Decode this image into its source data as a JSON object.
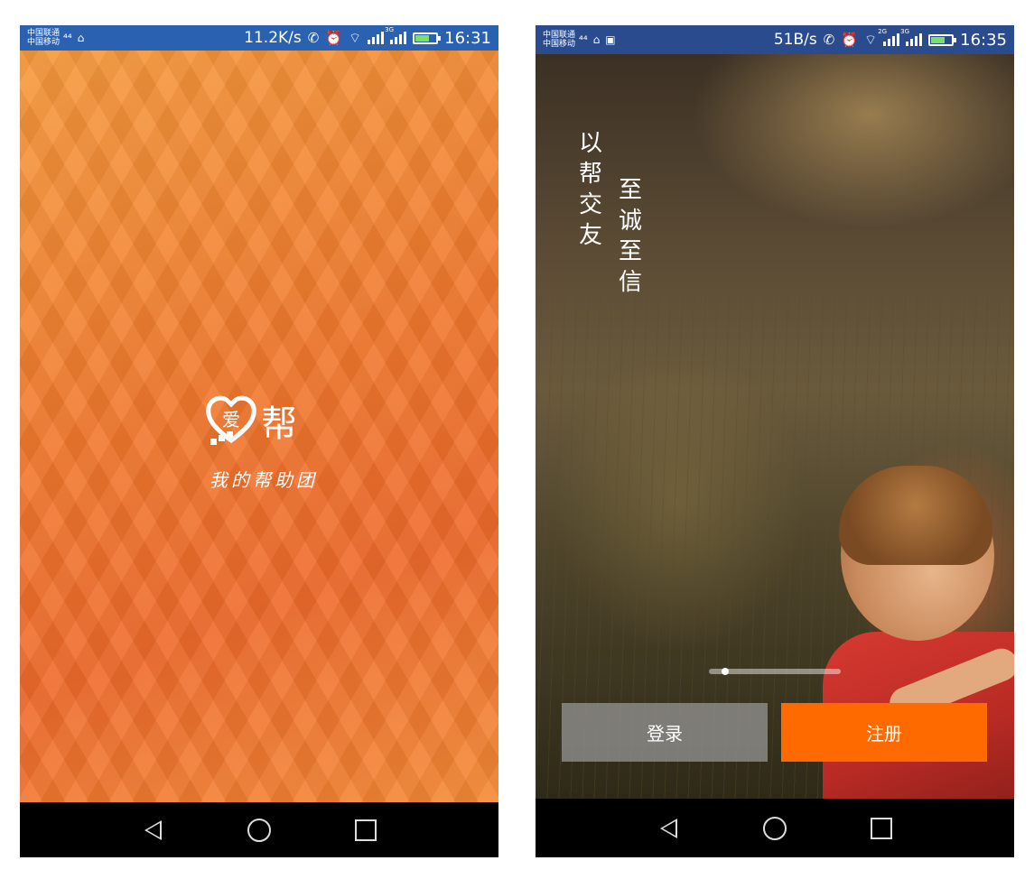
{
  "splash_screen": {
    "status_bar": {
      "carrier_top": "中国联通",
      "carrier_bottom": "中国移动",
      "network_speed": "11.2K/s",
      "signal_1_tag": "",
      "signal_2_tag": "3G",
      "time": "16:31"
    },
    "logo_text": "帮",
    "logo_icon": "heart-ai-icon",
    "slogan": "我的帮助团",
    "background_color": "#f07a2e"
  },
  "login_screen": {
    "status_bar": {
      "carrier_top": "中国联通",
      "carrier_bottom": "中国移动",
      "network_speed": "51B/s",
      "signal_1_tag": "2G",
      "signal_2_tag": "3G",
      "time": "16:35"
    },
    "slogan_column_1": [
      "以",
      "帮",
      "交",
      "友"
    ],
    "slogan_column_2": [
      "至",
      "诚",
      "至",
      "信"
    ],
    "login_label": "登录",
    "register_label": "注册",
    "register_color": "#ff6a00",
    "pager": {
      "pages": 2,
      "current": 1
    }
  },
  "navigation_bar": {
    "icons": [
      "back-icon",
      "home-icon",
      "recent-apps-icon"
    ]
  }
}
